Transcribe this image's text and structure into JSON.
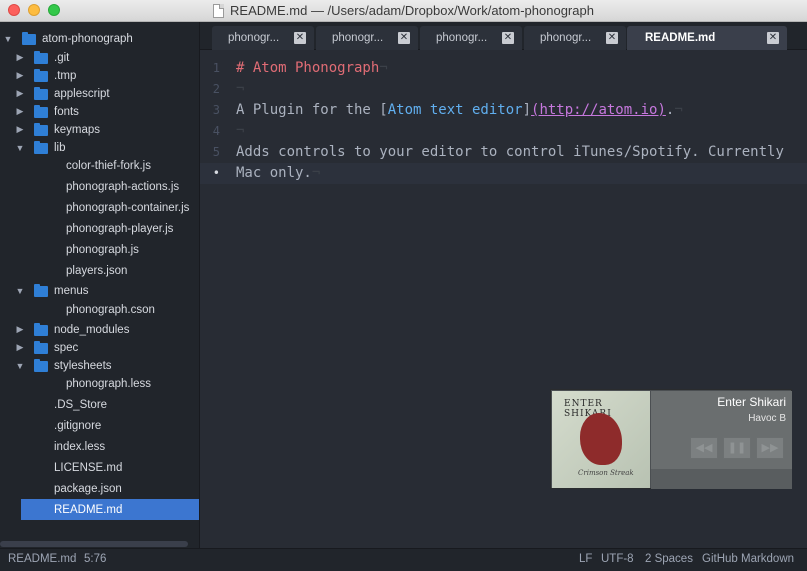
{
  "window": {
    "title": "README.md — /Users/adam/Dropbox/Work/atom-phonograph"
  },
  "tree": {
    "root": "atom-phonograph",
    "items": [
      {
        "label": ".git",
        "type": "folder",
        "expanded": false
      },
      {
        "label": ".tmp",
        "type": "folder",
        "expanded": false
      },
      {
        "label": "applescript",
        "type": "folder",
        "expanded": false
      },
      {
        "label": "fonts",
        "type": "folder",
        "expanded": false
      },
      {
        "label": "keymaps",
        "type": "folder",
        "expanded": false
      },
      {
        "label": "lib",
        "type": "folder",
        "expanded": true
      },
      {
        "label": "color-thief-fork.js",
        "type": "file"
      },
      {
        "label": "phonograph-actions.js",
        "type": "file"
      },
      {
        "label": "phonograph-container.js",
        "type": "file"
      },
      {
        "label": "phonograph-player.js",
        "type": "file"
      },
      {
        "label": "phonograph.js",
        "type": "file"
      },
      {
        "label": "players.json",
        "type": "file"
      },
      {
        "label": "menus",
        "type": "folder",
        "expanded": true
      },
      {
        "label": "phonograph.cson",
        "type": "file"
      },
      {
        "label": "node_modules",
        "type": "folder",
        "expanded": false
      },
      {
        "label": "spec",
        "type": "folder",
        "expanded": false
      },
      {
        "label": "stylesheets",
        "type": "folder",
        "expanded": true
      },
      {
        "label": "phonograph.less",
        "type": "file"
      },
      {
        "label": ".DS_Store",
        "type": "file"
      },
      {
        "label": ".gitignore",
        "type": "file"
      },
      {
        "label": "index.less",
        "type": "file"
      },
      {
        "label": "LICENSE.md",
        "type": "file"
      },
      {
        "label": "package.json",
        "type": "file"
      },
      {
        "label": "README.md",
        "type": "file",
        "selected": true
      }
    ]
  },
  "tabs": [
    {
      "label": "phonogr...",
      "active": false
    },
    {
      "label": "phonogr...",
      "active": false
    },
    {
      "label": "phonogr...",
      "active": false
    },
    {
      "label": "phonogr...",
      "active": false
    },
    {
      "label": "README.md",
      "active": true
    }
  ],
  "editor": {
    "line_numbers": [
      "1",
      "2",
      "3",
      "4",
      "5",
      "•"
    ],
    "lines": {
      "l1_head": "# Atom Phonograph",
      "l3_a": "A Plugin for the [",
      "l3_link": "Atom text editor",
      "l3_b": "]",
      "l3_url": "(http://atom.io)",
      "l3_c": ".",
      "l5": "Adds controls to your editor to control iTunes/Spotify. Currently",
      "l6": "Mac only.",
      "eol": "¬"
    }
  },
  "player": {
    "artist": "Enter Shikari",
    "album": "Havoc B",
    "cover_title": "ENTER SHIKARI",
    "cover_subtitle": "Crimson Streak",
    "prev_icon": "rewind-icon",
    "play_icon": "pause-icon",
    "next_icon": "fast-forward-icon",
    "progress": 0.0
  },
  "status": {
    "file": "README.md",
    "cursor": "5:76",
    "line_ending": "LF",
    "encoding": "UTF-8",
    "indent": "2 Spaces",
    "grammar": "GitHub Markdown"
  },
  "colors": {
    "heading": "#e06c75",
    "link_text": "#61afef",
    "link_url": "#c678dd",
    "selection": "#3c76d0"
  }
}
